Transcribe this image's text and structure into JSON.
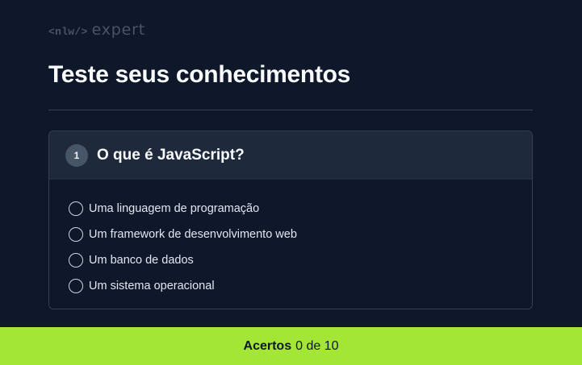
{
  "brand": {
    "code_mark": "<nlw/>",
    "word": "expert"
  },
  "page": {
    "title": "Teste seus conhecimentos"
  },
  "question": {
    "number": "1",
    "text": "O que é JavaScript?",
    "answers": [
      {
        "label": "Uma linguagem de programação",
        "selected": false
      },
      {
        "label": "Um framework de desenvolvimento web",
        "selected": false
      },
      {
        "label": "Um banco de dados",
        "selected": false
      },
      {
        "label": "Um sistema operacional",
        "selected": false
      }
    ]
  },
  "footer": {
    "label": "Acertos",
    "score": "0 de 10"
  },
  "colors": {
    "background": "#0f172a",
    "card_header": "#1e293b",
    "accent": "#a3e635"
  }
}
